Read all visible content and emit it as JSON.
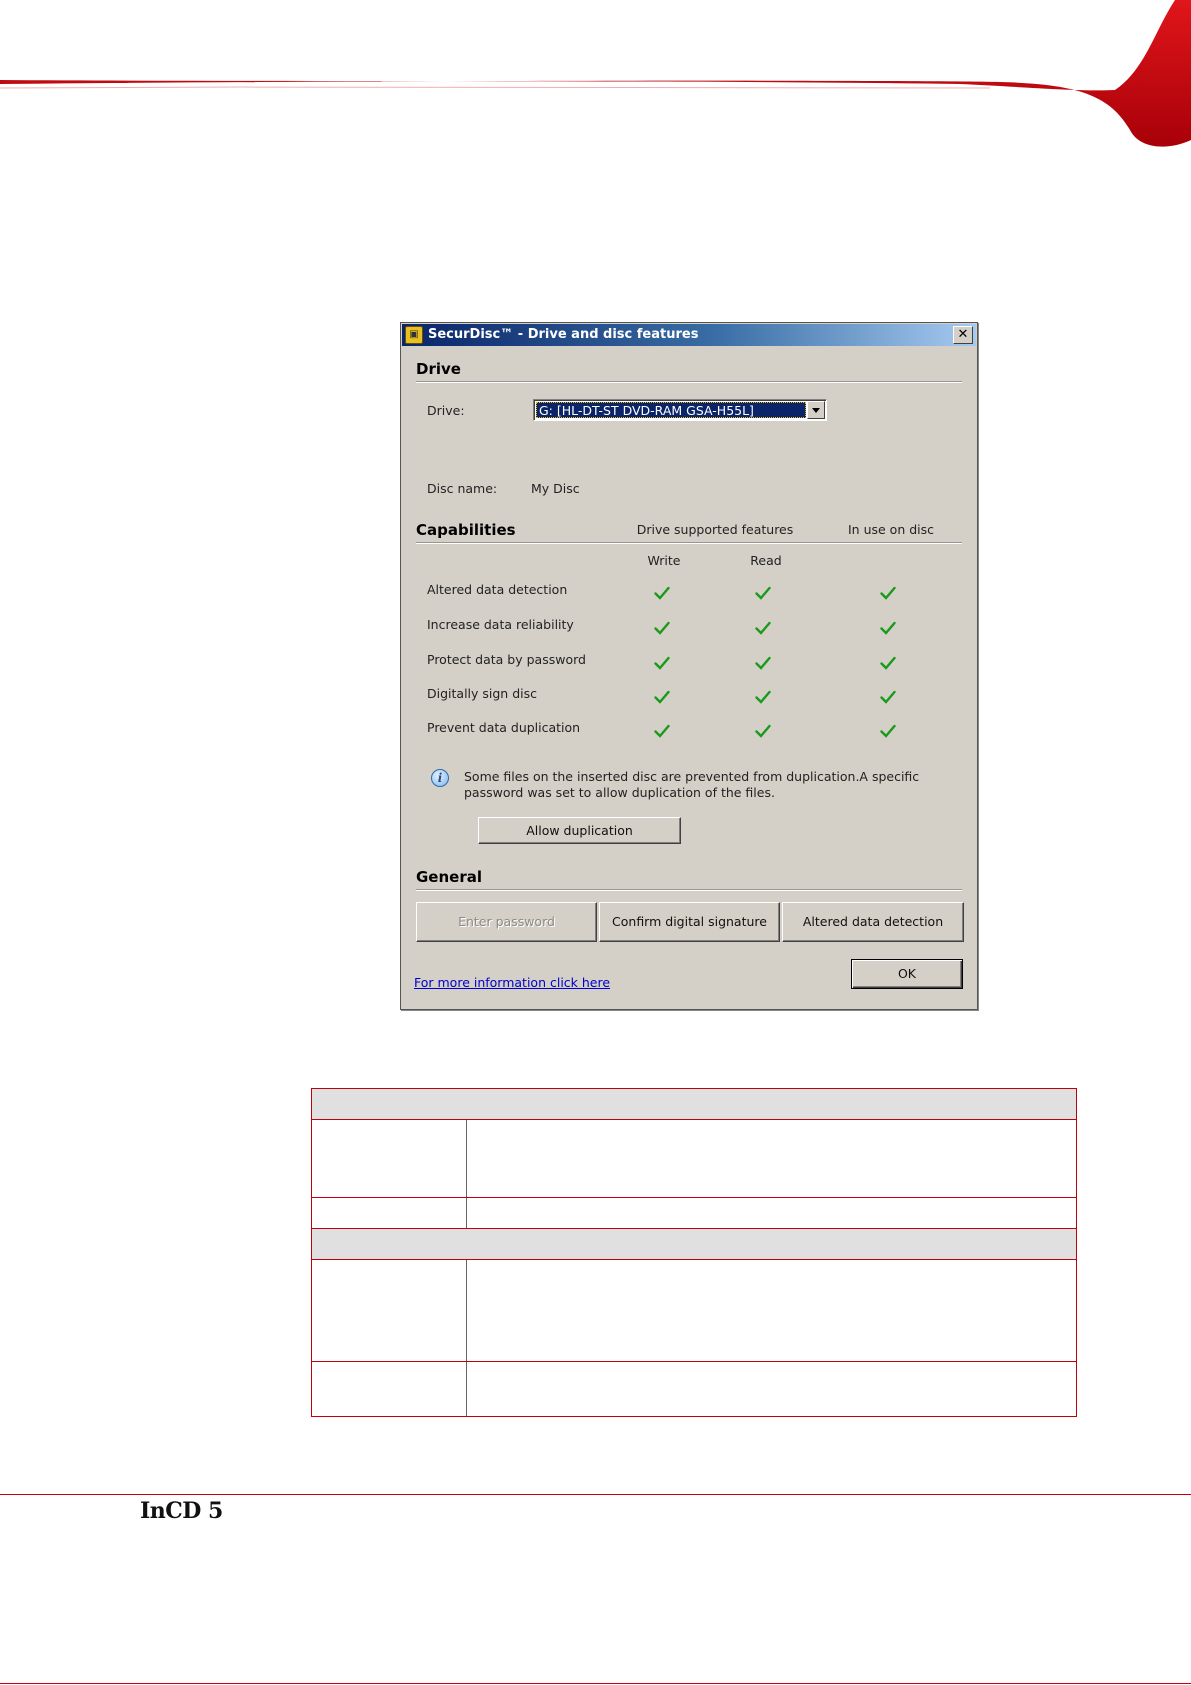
{
  "dialog": {
    "title": "SecurDisc™ - Drive and disc features",
    "close_glyph": "✕",
    "drive_section": "Drive",
    "drive_label": "Drive:",
    "drive_value": "G: [HL-DT-ST DVD-RAM GSA-H55L]",
    "disc_name_label": "Disc name:",
    "disc_name_value": "My Disc",
    "capabilities_section": "Capabilities",
    "col_drive_supported": "Drive supported features",
    "col_in_use": "In use on disc",
    "col_write": "Write",
    "col_read": "Read",
    "capabilities": [
      {
        "label": "Altered data detection",
        "write": true,
        "read": true,
        "in_use": true
      },
      {
        "label": "Increase data reliability",
        "write": true,
        "read": true,
        "in_use": true
      },
      {
        "label": "Protect data by password",
        "write": true,
        "read": true,
        "in_use": true
      },
      {
        "label": "Digitally sign disc",
        "write": true,
        "read": true,
        "in_use": true
      },
      {
        "label": "Prevent data duplication",
        "write": true,
        "read": true,
        "in_use": true
      }
    ],
    "info_text": "Some files on the inserted disc are prevented from duplication.A specific password was set to allow duplication of the files.",
    "allow_duplication_button": "Allow duplication",
    "general_section": "General",
    "enter_password_button": "Enter password",
    "confirm_signature_button": "Confirm digital signature",
    "altered_detection_button": "Altered data detection",
    "more_info_link": "For more information click here",
    "ok_button": "OK",
    "colors": {
      "check": "#1a9a1a",
      "title_start": "#0a246a",
      "title_end": "#a6caf0"
    }
  },
  "footer": {
    "brand": "InCD 5"
  },
  "colors": {
    "accent": "#c0000a"
  }
}
